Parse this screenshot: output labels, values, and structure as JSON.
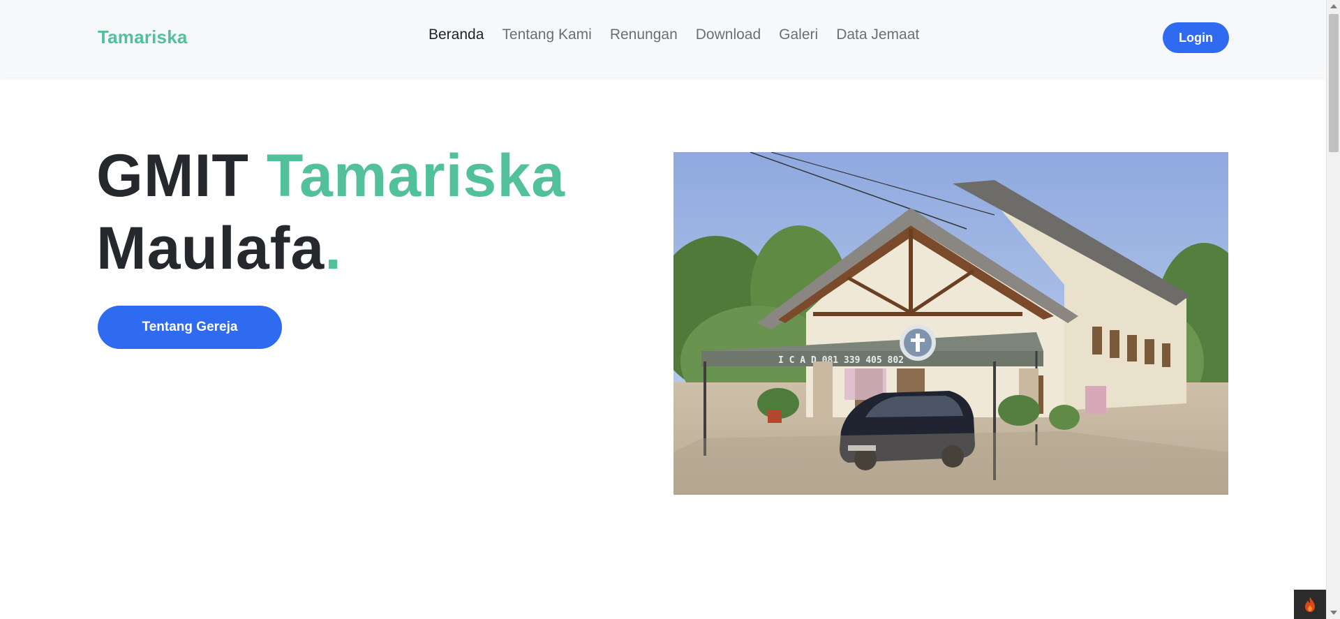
{
  "navbar": {
    "brand": "Tamariska",
    "menu": [
      {
        "label": "Beranda",
        "active": true
      },
      {
        "label": "Tentang Kami",
        "active": false
      },
      {
        "label": "Renungan",
        "active": false
      },
      {
        "label": "Download",
        "active": false
      },
      {
        "label": "Galeri",
        "active": false
      },
      {
        "label": "Data Jemaat",
        "active": false
      }
    ],
    "login_label": "Login"
  },
  "hero": {
    "title_part1": "GMIT ",
    "title_accent": "Tamariska",
    "title_part2": "Maulafa",
    "title_dot": ".",
    "button_label": "Tentang Gereja",
    "image_canopy_text": "I C A D   081 339 405 802"
  },
  "colors": {
    "brand_green": "#52c19b",
    "primary_blue": "#2f6bf0",
    "heading_dark": "#25282c",
    "nav_text": "#6b6f74",
    "navbar_bg": "#f7f8fa"
  },
  "icons": {
    "debug_toolbar": "flame-icon",
    "church_emblem": "cross-icon"
  }
}
